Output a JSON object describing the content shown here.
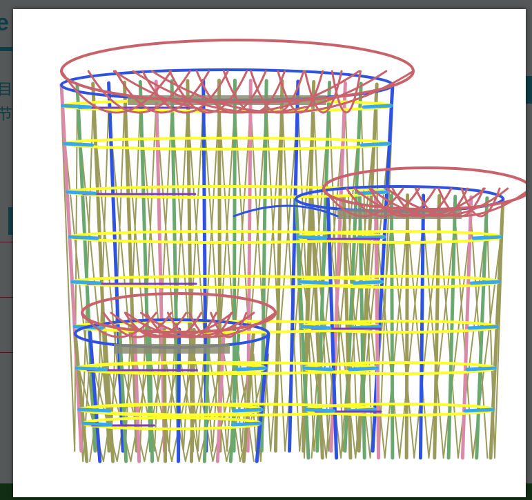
{
  "background_page": {
    "title_fragment": "e",
    "side_text_lines": [
      "目",
      "节"
    ]
  },
  "lightbox": {
    "image_alt": "",
    "colors": {
      "roof_arch": "#c8636b",
      "column_pink": "#d98aa8",
      "column_green": "#6aa86f",
      "column_olive": "#9a9a5a",
      "column_blue": "#2f53e0",
      "ring_yellow": "#ffff2e",
      "ring_purple": "#7a3fb5",
      "ring_lightblue": "#3aa8e8",
      "slab_gray": "#8c8c6e",
      "overlay": "#000000"
    }
  }
}
